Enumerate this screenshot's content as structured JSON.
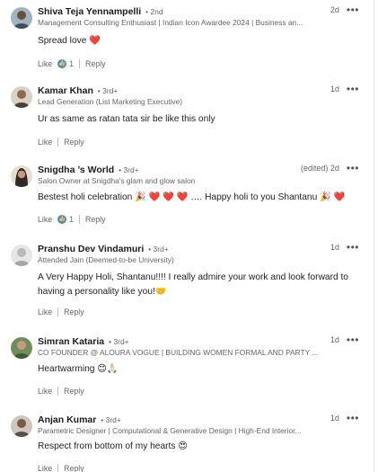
{
  "comments": [
    {
      "name": "Shiva Teja Yennampelli",
      "degree": "• 2nd",
      "headline": "Management Consulting Enthusiast | Indian Icon Awardee 2024 | Business an...",
      "time": "2d",
      "text": "Spread love ❤️",
      "like": "Like",
      "reaction_count": "1",
      "reply": "Reply",
      "avatar_color": "#6b7f8e"
    },
    {
      "name": "Kamar Khan",
      "degree": "• 3rd+",
      "headline": "Lead Generation (List Marketing Executive)",
      "time": "1d",
      "text": "Ur as same as ratan tata sir be like this only",
      "like": "Like",
      "reply": "Reply",
      "avatar_color": "#4b4038"
    },
    {
      "name": "Snigdha ’s World",
      "degree": "• 3rd+",
      "headline": "Salon Owner at Snigdha's glam and glow salon",
      "time": "(edited) 2d",
      "text": "Bestest holi celebration 🎉 ❤️ ❤️ ❤️ …. Happy holi to you Shantanu 🎉 ❤️",
      "like": "Like",
      "reaction_count": "1",
      "reply": "Reply",
      "avatar_color": "#2f2a28"
    },
    {
      "name": "Pranshu Dev Vindamuri",
      "degree": "• 3rd+",
      "headline": "Attended Jain (Deemed-to-be University)",
      "time": "1d",
      "text": "A Very Happy Holi, Shantanu!!!! I really admire your work and look forward to having a personality like you!🤝",
      "like": "Like",
      "reply": "Reply",
      "avatar_color": "#c9c9c9"
    },
    {
      "name": "Simran Kataria",
      "degree": "• 3rd+",
      "headline": "CO FOUNDER @ ALOURA VOGUE | BUILDING WOMEN FORMAL AND PARTY ...",
      "time": "1d",
      "text": "Heartwarming 😊🙏🏻",
      "like": "Like",
      "reply": "Reply",
      "avatar_color": "#3f5a3a"
    },
    {
      "name": "Anjan Kumar",
      "degree": "• 3rd+",
      "headline": "Parametric Designer | Computational & Generative Design | High-End Interior...",
      "time": "1d",
      "text": "Respect from bottom of my hearts 😍",
      "like": "Like",
      "reply": "Reply",
      "avatar_color": "#56504a"
    }
  ],
  "icons": {
    "more": "more-horizontal-icon",
    "reaction": "thumbs-up-icon"
  },
  "colors": {
    "reaction_blue": "#378fe9",
    "muted_text": "#666666"
  }
}
